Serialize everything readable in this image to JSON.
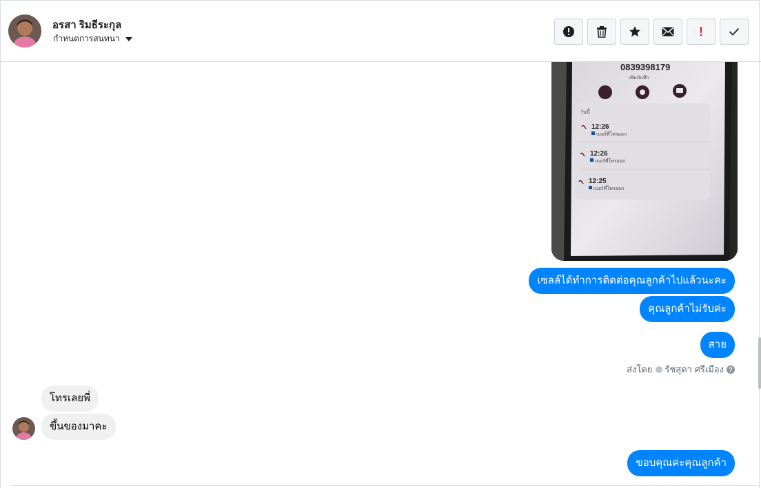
{
  "header": {
    "contact_name": "อรสา ริมธีระกุล",
    "assign_label": "กำหนดการสนทนา",
    "avatar_icon": "user-avatar-icon"
  },
  "toolbar": {
    "buttons": [
      {
        "icon": "alert-circle-icon",
        "label": ""
      },
      {
        "icon": "trash-icon",
        "label": ""
      },
      {
        "icon": "star-icon",
        "label": ""
      },
      {
        "icon": "envelope-icon",
        "label": ""
      },
      {
        "icon": "exclamation-icon",
        "label": "!",
        "color": "#e41e3f"
      },
      {
        "icon": "checkmark-icon",
        "label": ""
      }
    ]
  },
  "photo": {
    "phone_number": "0839398179",
    "add_note": "เพิ่มบันทึก",
    "section_label": "วันนี้",
    "calls": [
      {
        "time": "12:26",
        "label": "เบอร์ที่โทรออก"
      },
      {
        "time": "12:26",
        "label": "เบอร์ที่โทรออก"
      },
      {
        "time": "12:25",
        "label": "เบอร์ที่โทรออก"
      }
    ]
  },
  "messages": {
    "outgoing": [
      "เซลล์ได้ทำการติดต่อคุณลูกค้าไปแล้วนะคะ",
      "คุณลูกค้าไม่รับค่ะ",
      "สาย"
    ],
    "sent_by_prefix": "ส่งโดย",
    "sent_by_name": "รัชสุดา ศรีเมือง",
    "incoming": [
      "โทรเลยพี่",
      "ขึ้นของมาคะ"
    ],
    "final_outgoing": "ขอบคุณค่ะคุณลูกค้า"
  },
  "colors": {
    "accent": "#0084ff",
    "incoming_bubble": "#f0f0f0",
    "alert_red": "#e41e3f"
  }
}
